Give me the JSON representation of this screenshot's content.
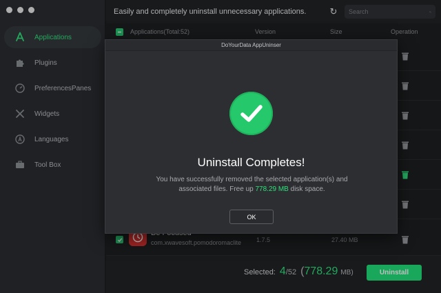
{
  "window": {
    "traffic_lights": [
      "close",
      "minimize",
      "zoom"
    ]
  },
  "sidebar": {
    "items": [
      {
        "label": "Applications",
        "icon": "app-store-icon",
        "active": true
      },
      {
        "label": "Plugins",
        "icon": "puzzle-icon",
        "active": false
      },
      {
        "label": "PreferencesPanes",
        "icon": "gauge-icon",
        "active": false
      },
      {
        "label": "Widgets",
        "icon": "tools-icon",
        "active": false
      },
      {
        "label": "Languages",
        "icon": "language-icon",
        "active": false
      },
      {
        "label": "Tool Box",
        "icon": "toolbox-icon",
        "active": false
      }
    ]
  },
  "header": {
    "title": "Easily and completely uninstall unnecessary applications.",
    "search_placeholder": "Search"
  },
  "columns": {
    "applications": "Applications(Total:52)",
    "version": "Version",
    "size": "Size",
    "operation": "Operation"
  },
  "visible_app": {
    "name": "Be Focused",
    "bundle_id": "com.xwavesoft.pomodoromaclite",
    "version": "1.7.5",
    "size": "27.40 MB",
    "checked": true
  },
  "footer": {
    "selected_label": "Selected:",
    "selected_count": "4",
    "total_count": "/52",
    "open_paren": "(",
    "total_size": "778.29",
    "size_unit": "MB)",
    "uninstall_label": "Uninstall"
  },
  "dialog": {
    "title": "DoYourData AppUninser",
    "heading": "Uninstall Completes!",
    "message_line1": "You have successfully removed the selected application(s) and",
    "message_line2_prefix": "associated files. Free up ",
    "freed_size": "778.29 MB",
    "message_line2_suffix": " disk space.",
    "ok_label": "OK"
  },
  "colors": {
    "accent_green": "#2fe07c",
    "button_green": "#22e07a",
    "background": "#1e1f21",
    "sidebar": "#2a2c30",
    "dialog": "#2d2e31"
  }
}
